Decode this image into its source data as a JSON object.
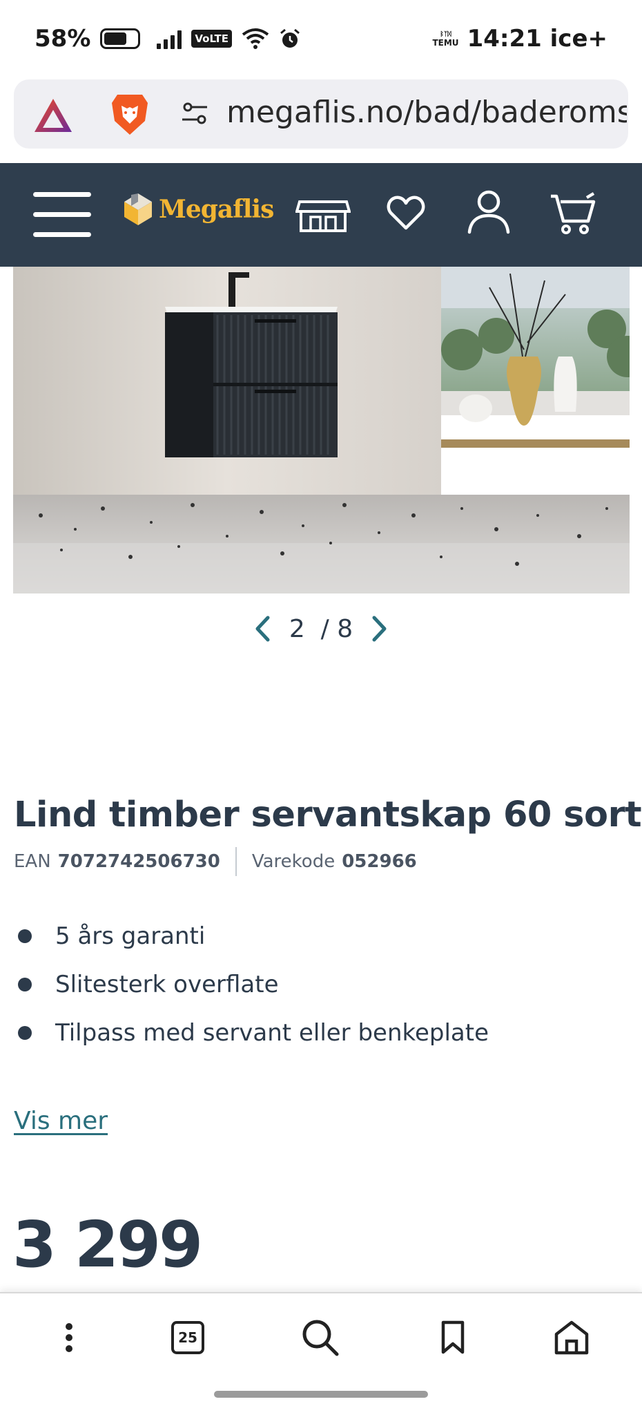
{
  "status_bar": {
    "battery_percent": "58%",
    "network_label": "VoLTE",
    "temu_label_top": "ᛒᛉᛞ",
    "temu_label_bottom": "TEMU",
    "time": "14:21",
    "carrier": "ice+"
  },
  "browser": {
    "url": "megaflis.no/bad/baderoms"
  },
  "header": {
    "logo_text": "Megaflis",
    "icons": [
      "menu-icon",
      "store-icon",
      "heart-icon",
      "user-icon",
      "cart-icon"
    ]
  },
  "gallery": {
    "current": "2",
    "separator": "/",
    "total": "8"
  },
  "product": {
    "title": "Lind timber servantskap 60 sort",
    "ean_label": "EAN",
    "ean_value": "7072742506730",
    "code_label": "Varekode",
    "code_value": "052966",
    "features": [
      "5 års garanti",
      "Slitesterk overflate",
      "Tilpass med servant eller benkeplate"
    ],
    "more_link": "Vis mer",
    "price": "3 299"
  },
  "bottom_nav": {
    "tabs_count": "25"
  },
  "colors": {
    "header_bg": "#2f3e4e",
    "logo": "#f2b533",
    "link": "#2a6f7d",
    "text": "#2c3a4a"
  }
}
